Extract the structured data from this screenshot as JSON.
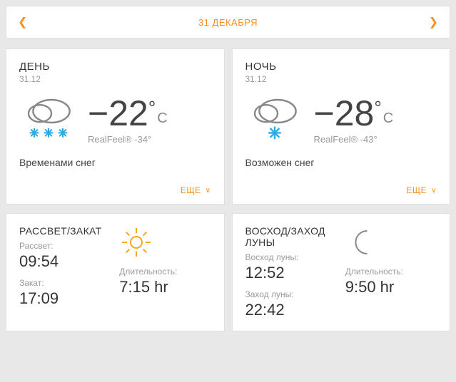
{
  "nav": {
    "date": "31 ДЕКАБРЯ"
  },
  "day": {
    "title": "ДЕНЬ",
    "date": "31.12",
    "temp": "−22",
    "unit": "C",
    "realfeel": "RealFeel® -34°",
    "condition": "Временами снег",
    "more": "ЕЩЕ"
  },
  "night": {
    "title": "НОЧЬ",
    "date": "31.12",
    "temp": "−28",
    "unit": "C",
    "realfeel": "RealFeel® -43°",
    "condition": "Возможен снег",
    "more": "ЕЩЕ"
  },
  "sun": {
    "title": "РАССВЕТ/ЗАКАТ",
    "rise_label": "Рассвет:",
    "rise": "09:54",
    "set_label": "Закат:",
    "set": "17:09",
    "dur_label": "Длительность:",
    "dur": "7:15 hr"
  },
  "moon": {
    "title": "ВОСХОД/ЗАХОД ЛУНЫ",
    "rise_label": "Восход луны:",
    "rise": "12:52",
    "set_label": "Заход луны:",
    "set": "22:42",
    "dur_label": "Длительность:",
    "dur": "9:50 hr"
  }
}
